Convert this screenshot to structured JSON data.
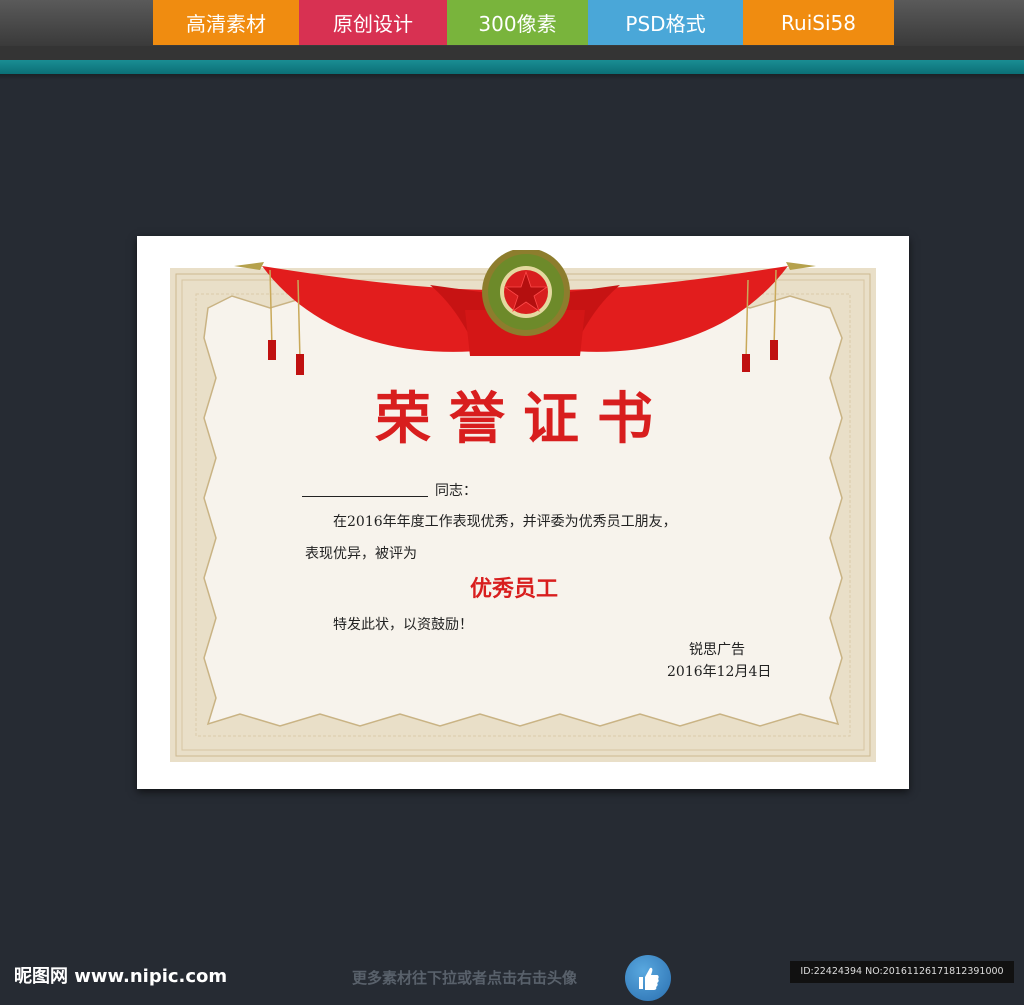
{
  "banner": {
    "tabs": [
      {
        "label": "高清素材",
        "color": "#f08c10"
      },
      {
        "label": "原创设计",
        "color": "#d83152"
      },
      {
        "label": "300像素",
        "color": "#79b43c"
      },
      {
        "label": "PSD格式",
        "color": "#4aa7d8"
      },
      {
        "label": "RuiSi58",
        "color": "#f08c10"
      }
    ]
  },
  "certificate": {
    "title": "荣誉证书",
    "salutation": "同志：",
    "body_line1": "在2016年年度工作表现优秀，并评委为优秀员工朋友，",
    "body_line2": "表现优异，被评为",
    "award": "优秀员工",
    "closing": "特发此状，以资鼓励！",
    "issuer": "锐思广告",
    "date": "2016年12月4日",
    "accent_color": "#d81e1e"
  },
  "footer": {
    "site_logo": "昵图网 www.nipic.com",
    "hint": "更多素材往下拉或者点击右击头像",
    "id_info": "ID:22424394 NO:20161126171812391000"
  }
}
